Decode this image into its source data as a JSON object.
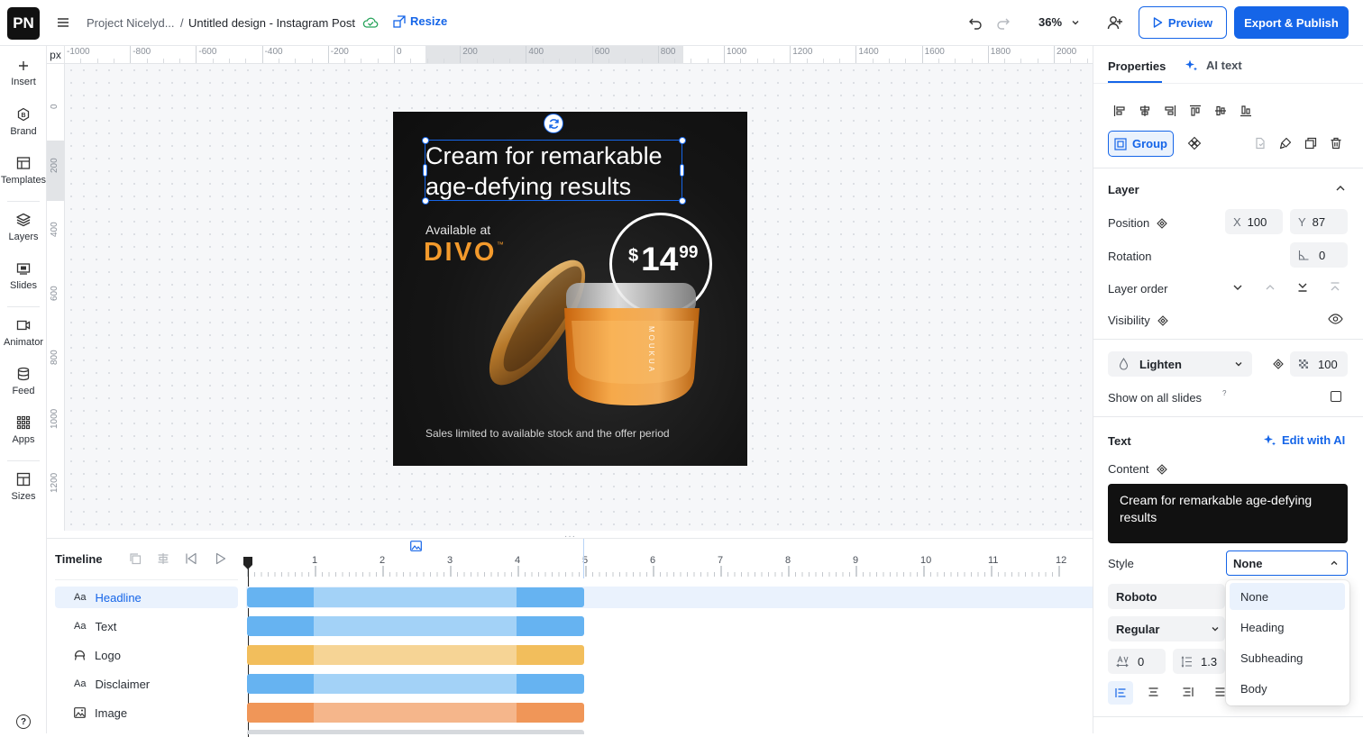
{
  "app": {
    "logo": "PN"
  },
  "header": {
    "project": "Project Nicelyd...",
    "separator": "/",
    "design_title": "Untitled design - Instagram Post",
    "resize": "Resize",
    "zoom": "36%",
    "preview": "Preview",
    "export": "Export & Publish"
  },
  "leftbar": {
    "items": [
      {
        "label": "Insert",
        "icon": "plus-icon"
      },
      {
        "label": "Brand",
        "icon": "brand-icon"
      },
      {
        "label": "Templates",
        "icon": "templates-icon"
      },
      {
        "label": "Layers",
        "icon": "layers-icon"
      },
      {
        "label": "Slides",
        "icon": "slides-icon"
      },
      {
        "label": "Animator",
        "icon": "animator-icon"
      },
      {
        "label": "Feed",
        "icon": "feed-icon"
      },
      {
        "label": "Apps",
        "icon": "apps-icon"
      },
      {
        "label": "Sizes",
        "icon": "sizes-icon"
      }
    ],
    "help": "?"
  },
  "ruler": {
    "unit": "px",
    "top": [
      "-1000",
      "-800",
      "-600",
      "-400",
      "-200",
      "0",
      "200",
      "400",
      "600",
      "800",
      "1000",
      "1200",
      "1400",
      "1600",
      "1800",
      "2000"
    ],
    "left": [
      "0",
      "200",
      "400",
      "600",
      "800",
      "1000",
      "1200"
    ]
  },
  "artboard": {
    "headline": "Cream for remarkable age-defying results",
    "available": "Available at",
    "brand": "DIVO",
    "tm": "™",
    "price_currency": "$",
    "price_main": "14",
    "price_cents": "99",
    "jar_label": "MOUKUA",
    "disclaimer": "Sales limited to available stock and the offer period"
  },
  "timeline": {
    "title": "Timeline",
    "ticks": [
      "1",
      "2",
      "3",
      "4",
      "5",
      "6",
      "7",
      "8",
      "9",
      "10",
      "11",
      "12"
    ],
    "layers": [
      {
        "label": "Headline",
        "icon": "Aa",
        "selected": true
      },
      {
        "label": "Text",
        "icon": "Aa"
      },
      {
        "label": "Logo",
        "icon": "logo-icon"
      },
      {
        "label": "Disclaimer",
        "icon": "Aa"
      },
      {
        "label": "Image",
        "icon": "image-icon"
      }
    ],
    "colors": {
      "blue_dark": "#66b3f1",
      "blue_light": "#a3d2f7",
      "yellow_dark": "#f2be5c",
      "yellow_light": "#f6d495",
      "orange_dark": "#f09658",
      "orange_light": "#f5b68b"
    }
  },
  "panel": {
    "tabs": {
      "properties": "Properties",
      "ai_text": "AI text"
    },
    "group": "Group",
    "layer": {
      "title": "Layer",
      "position": "Position",
      "x_label": "X",
      "x": "100",
      "y_label": "Y",
      "y": "87",
      "rotation": "Rotation",
      "rotation_value": "0",
      "layer_order": "Layer order",
      "visibility": "Visibility",
      "blend": "Lighten",
      "opacity": "100",
      "show_all": "Show on all slides",
      "show_all_hint": "?"
    },
    "text": {
      "title": "Text",
      "edit_ai": "Edit with AI",
      "content_label": "Content",
      "content": "Cream for remarkable age-defying results",
      "style_label": "Style",
      "style_value": "None",
      "font": "Roboto",
      "weight": "Regular",
      "letter_spacing": "0",
      "line_height": "1.3",
      "style_options": [
        "None",
        "Heading",
        "Subheading",
        "Body"
      ]
    }
  },
  "colors": {
    "accent": "#1565e8",
    "brand_orange": "#f39a2c"
  }
}
